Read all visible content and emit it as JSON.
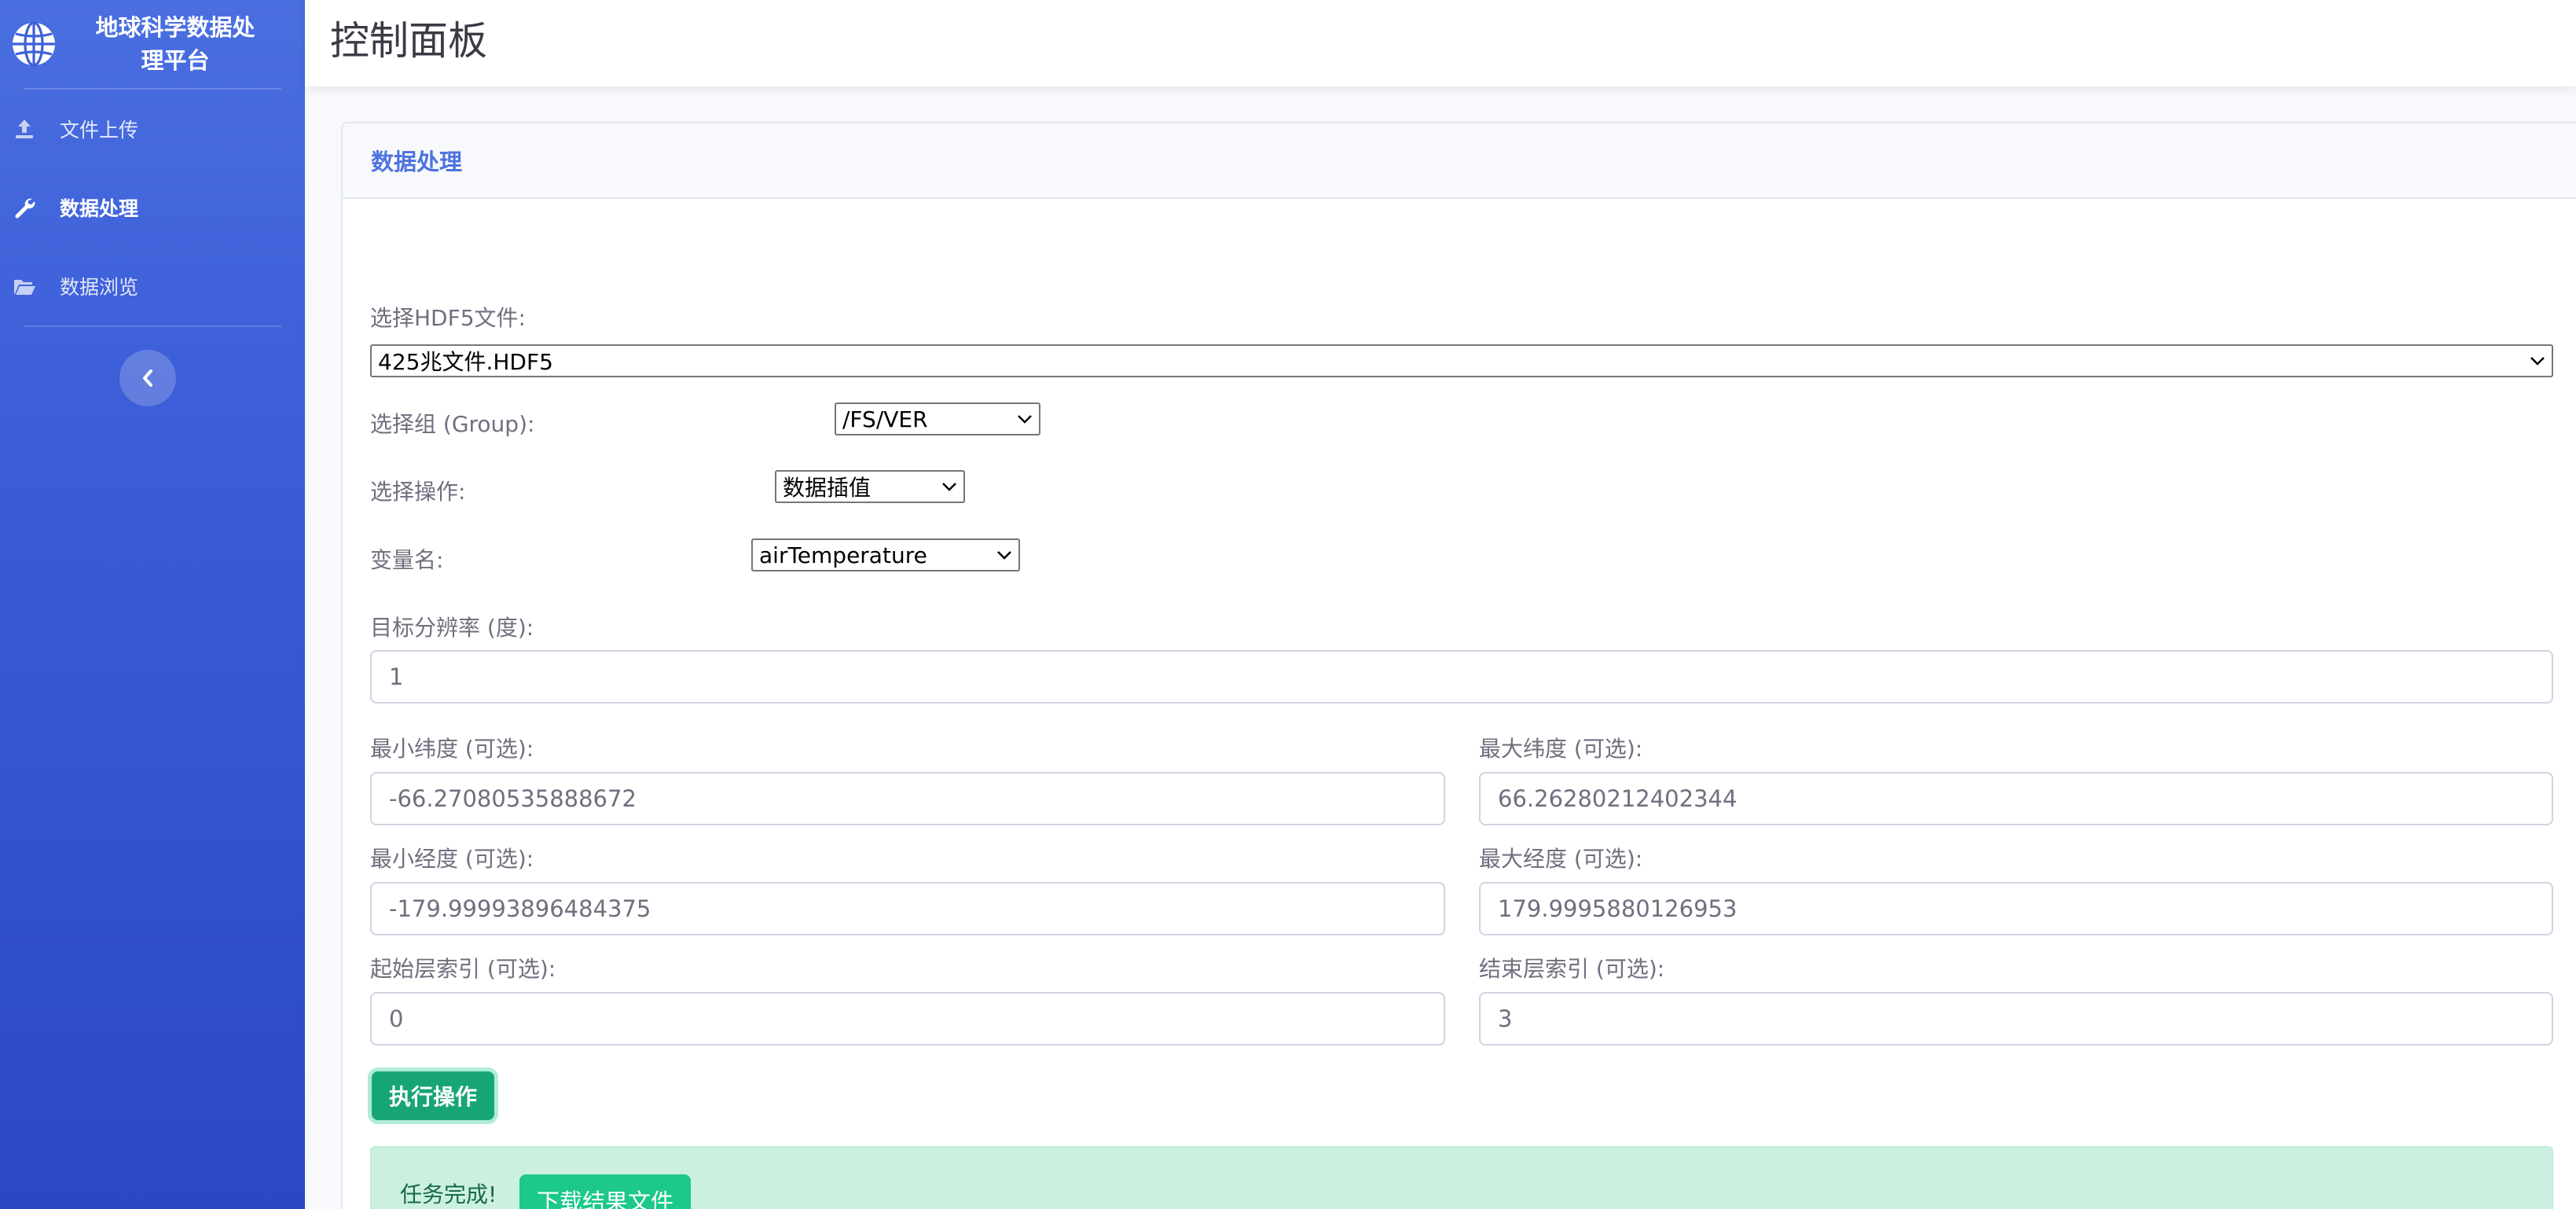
{
  "sidebar": {
    "brand_line1": "地球科学数据处",
    "brand_line2": "理平台",
    "items": [
      {
        "label": "文件上传",
        "icon": "upload-icon"
      },
      {
        "label": "数据处理",
        "icon": "wrench-icon",
        "active": true
      },
      {
        "label": "数据浏览",
        "icon": "folder-open-icon"
      }
    ],
    "toggle_icon": "chevron-left-icon"
  },
  "topbar": {
    "title": "控制面板"
  },
  "card": {
    "title": "数据处理",
    "file_label": "选择HDF5文件:",
    "file_value": "425兆文件.HDF5",
    "group_label": "选择组 (Group):",
    "group_value": "/FS/VER",
    "op_label": "选择操作:",
    "op_value": "数据插值",
    "var_label": "变量名:",
    "var_value": "airTemperature",
    "res_label": "目标分辨率 (度):",
    "res_value": "1",
    "min_lat_label": "最小纬度 (可选):",
    "min_lat_value": "-66.27080535888672",
    "max_lat_label": "最大纬度 (可选):",
    "max_lat_value": "66.26280212402344",
    "min_lon_label": "最小经度 (可选):",
    "min_lon_value": "-179.99993896484375",
    "max_lon_label": "最大经度 (可选):",
    "max_lon_value": "179.9995880126953",
    "start_layer_label": "起始层索引 (可选):",
    "start_layer_value": "0",
    "end_layer_label": "结束层索引 (可选):",
    "end_layer_value": "3",
    "exec_button": "执行操作",
    "done_text": "任务完成!",
    "download_button": "下载结果文件"
  },
  "colors": {
    "primary": "#4e73df",
    "success": "#1cc88a",
    "success_dark": "#17a673",
    "alert_bg": "#ccf0e0"
  }
}
